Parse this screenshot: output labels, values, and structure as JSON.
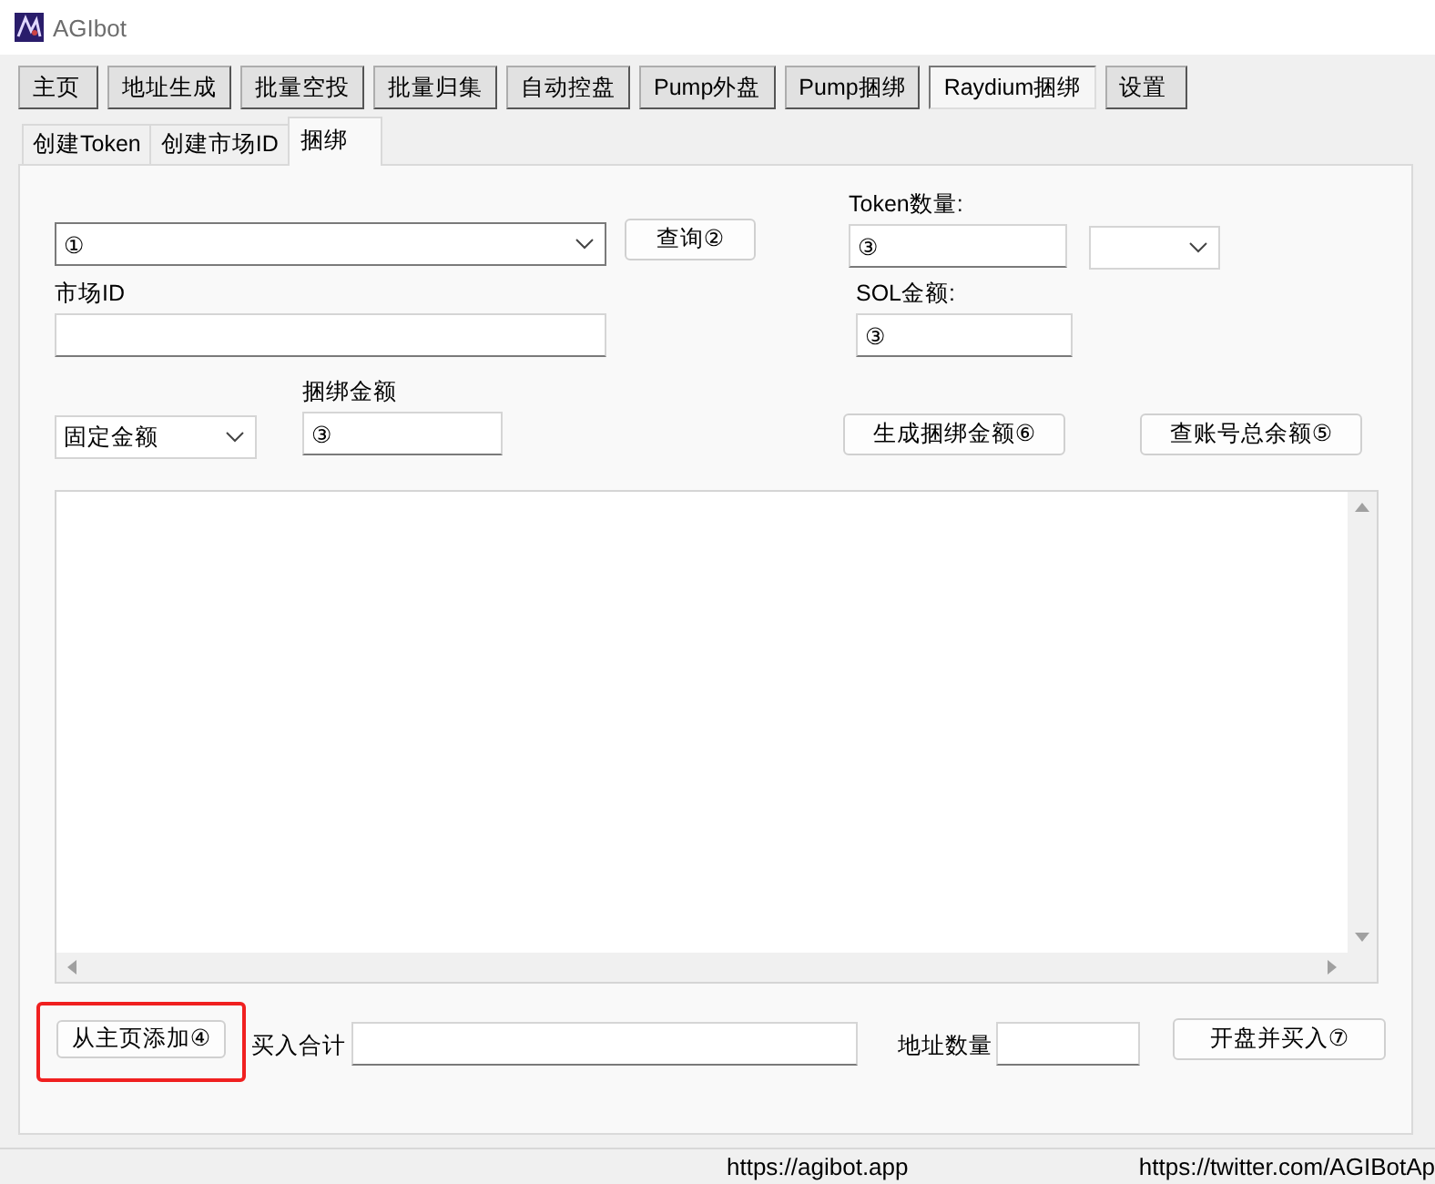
{
  "window": {
    "title": "AGIbot"
  },
  "menu": [
    {
      "label": "主页",
      "selected": false
    },
    {
      "label": "地址生成",
      "selected": false
    },
    {
      "label": "批量空投",
      "selected": false
    },
    {
      "label": "批量归集",
      "selected": false
    },
    {
      "label": "自动控盘",
      "selected": false
    },
    {
      "label": "Pump外盘",
      "selected": false
    },
    {
      "label": "Pump捆绑",
      "selected": false
    },
    {
      "label": "Raydium捆绑",
      "selected": true
    },
    {
      "label": "设置",
      "selected": false
    }
  ],
  "tabs": [
    {
      "label": "创建Token",
      "selected": false
    },
    {
      "label": "创建市场ID",
      "selected": false
    },
    {
      "label": "捆绑",
      "selected": true
    }
  ],
  "form": {
    "token_combo": {
      "value": "①"
    },
    "query_button": "查询②",
    "token_amount": {
      "label": "Token数量:",
      "value": "③"
    },
    "market_id": {
      "label": "市场ID"
    },
    "sol_amount": {
      "label": "SOL金额:",
      "value": "③"
    },
    "mode_combo": {
      "value": "固定金额"
    },
    "bundle_amount": {
      "label": "捆绑金额",
      "value": "③"
    },
    "generate_button": "生成捆绑金额⑥",
    "balance_button": "查账号总余额⑤",
    "add_button": {
      "label": "从主页添加④",
      "highlighted": true
    },
    "buy_total": {
      "label": "买入合计"
    },
    "address_count": {
      "label": "地址数量"
    },
    "launch_button": "开盘并买入⑦"
  },
  "status_bar": [
    "https://agibot.app",
    "https://twitter.com/AGIBotAp"
  ]
}
